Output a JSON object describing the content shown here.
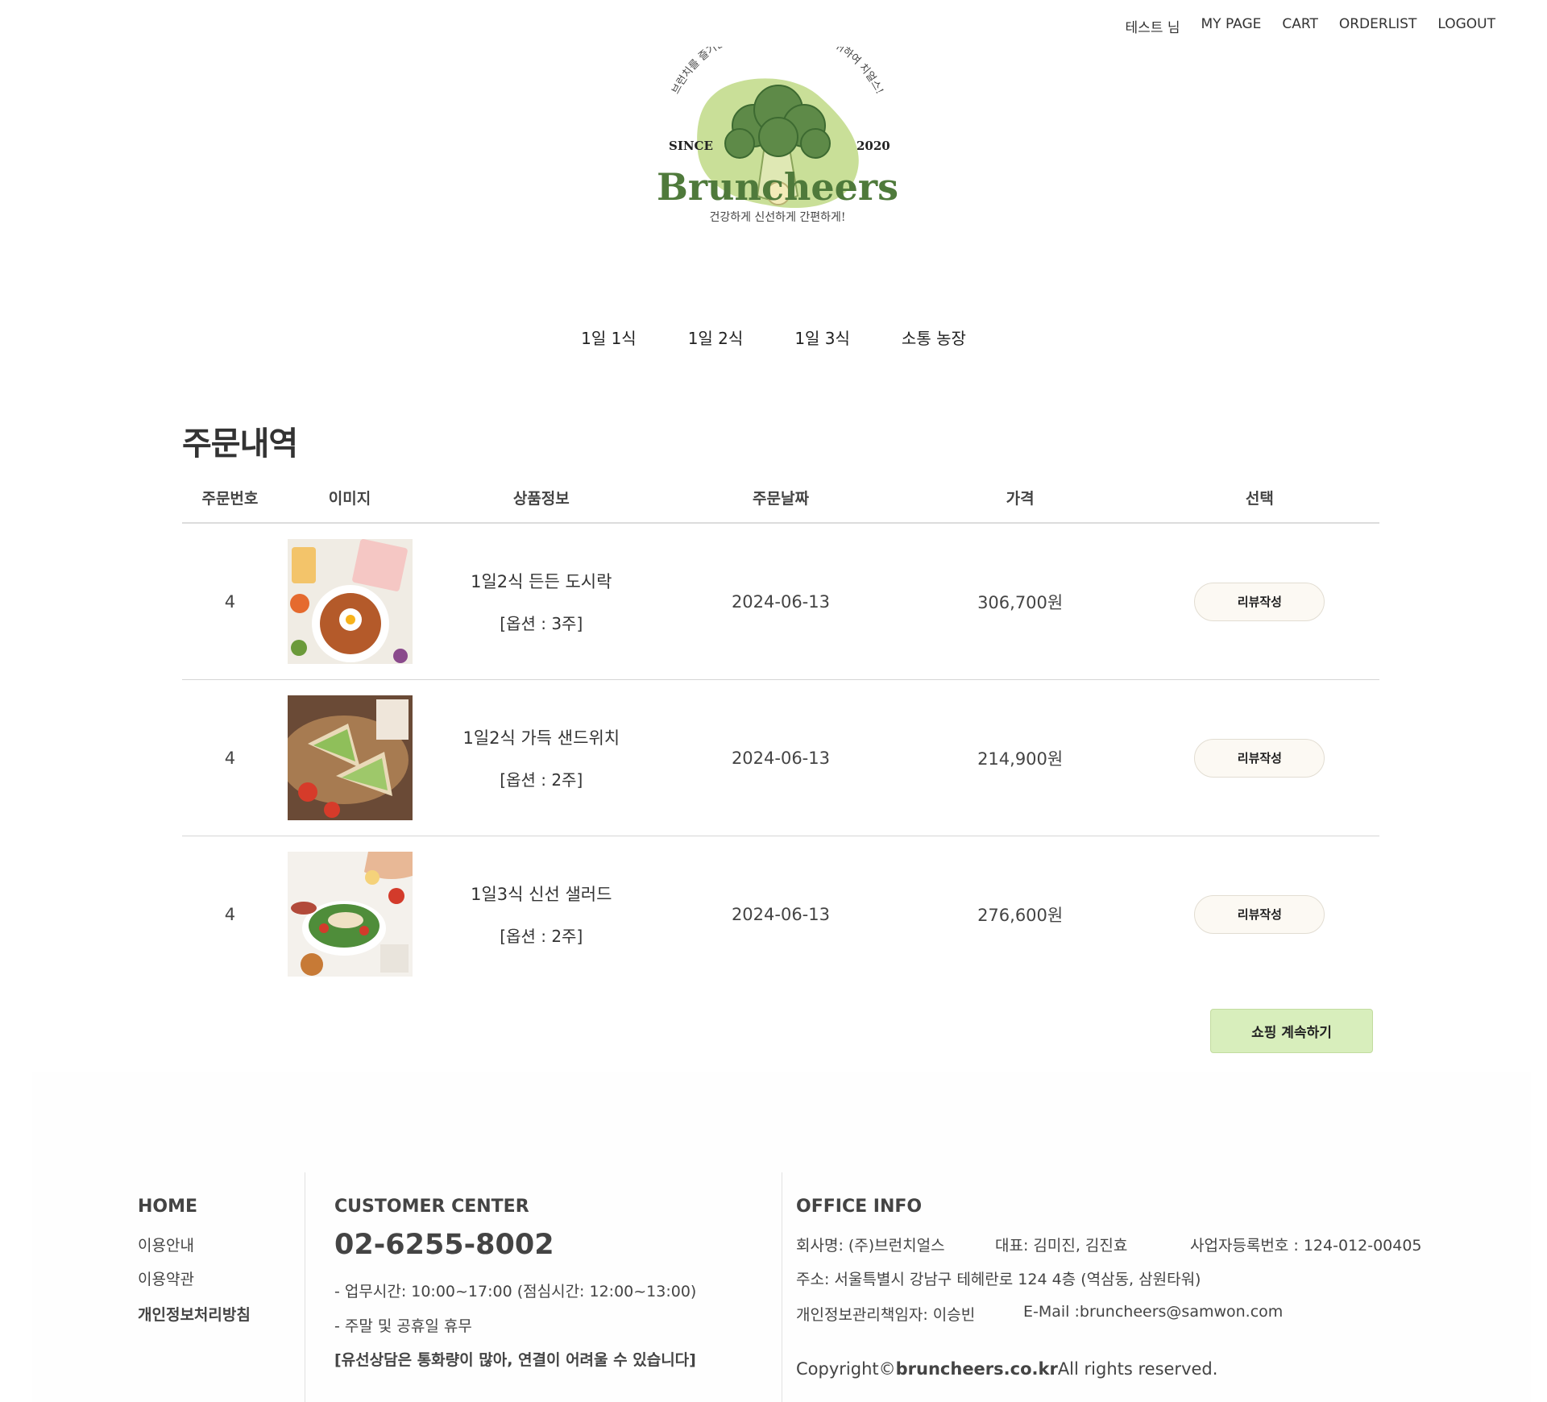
{
  "topbar": {
    "user": "테스트 님",
    "mypage": "MY PAGE",
    "cart": "CART",
    "orderlist": "ORDERLIST",
    "logout": "LOGOUT"
  },
  "logo": {
    "slogan_arc": "브런치를 즐기는 브런치어, 당신의 건강을 위하여 치얼스!",
    "since": "SINCE",
    "year": "2020",
    "brand": "Bruncheers",
    "tagline": "건강하게 신선하게 간편하게!"
  },
  "nav": [
    "1일 1식",
    "1일 2식",
    "1일 3식",
    "소통 농장"
  ],
  "page_title": "주문내역",
  "table": {
    "headers": [
      "주문번호",
      "이미지",
      "상품정보",
      "주문날짜",
      "가격",
      "선택"
    ],
    "rows": [
      {
        "order_no": "4",
        "name": "1일2식 든든 도시락",
        "option": "[옵션 : 3주]",
        "date": "2024-06-13",
        "price": "306,700원",
        "action": "리뷰작성"
      },
      {
        "order_no": "4",
        "name": "1일2식 가득 샌드위치",
        "option": "[옵션 : 2주]",
        "date": "2024-06-13",
        "price": "214,900원",
        "action": "리뷰작성"
      },
      {
        "order_no": "4",
        "name": "1일3식 신선 샐러드",
        "option": "[옵션 : 2주]",
        "date": "2024-06-13",
        "price": "276,600원",
        "action": "리뷰작성"
      }
    ]
  },
  "continue_label": "쇼핑 계속하기",
  "footer": {
    "home": {
      "title": "HOME",
      "items": [
        "이용안내",
        "이용약관",
        "개인정보처리방침"
      ]
    },
    "customer": {
      "title": "CUSTOMER CENTER",
      "phone": "02-6255-8002",
      "hours": "- 업무시간: 10:00~17:00 (점심시간: 12:00~13:00)",
      "holiday": "- 주말 및 공휴일 휴무",
      "notice": "[유선상담은 통화량이 많아, 연결이 어려울 수 있습니다]"
    },
    "office": {
      "title": "OFFICE INFO",
      "company": "회사명: (주)브런치얼스",
      "ceo": "대표: 김미진, 김진효",
      "bizno": "사업자등록번호 : 124-012-00405",
      "address": "주소: 서울특별시 강남구 테헤란로 124 4층 (역삼동, 삼원타워)",
      "privacy_officer": "개인정보관리책임자: 이승빈",
      "email": "E-Mail :bruncheers@samwon.com",
      "copyright_prefix": "Copyright©",
      "copyright_domain": "bruncheers.co.kr",
      "copyright_suffix": "All rights reserved."
    }
  },
  "colors": {
    "brand_green": "#4f7a3b",
    "leaf_light": "#c9df98",
    "button_green": "#d8eebc",
    "review_bg": "#fcf9f3"
  }
}
